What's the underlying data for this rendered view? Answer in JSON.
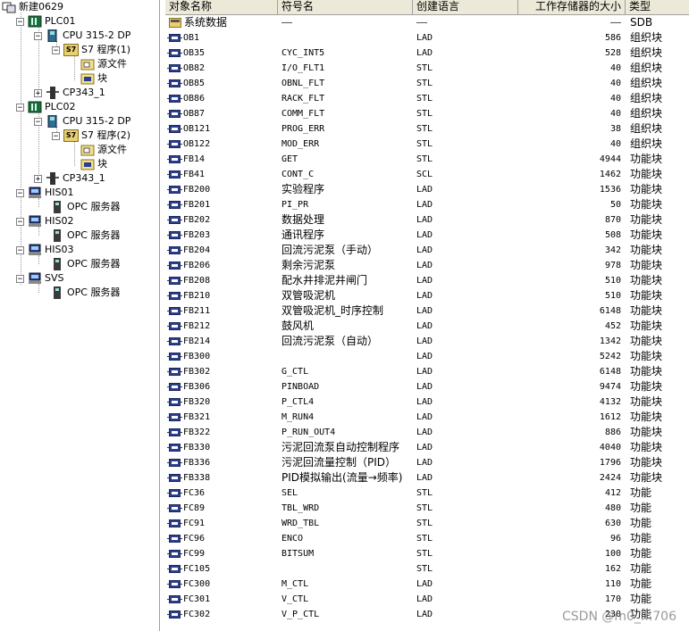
{
  "tree": {
    "project": "新建0629",
    "plc1": "PLC01",
    "cpu1": "CPU 315-2 DP",
    "prog1": "S7 程序(1)",
    "src1": "源文件",
    "blocks1": "块",
    "cp1": "CP343_1",
    "plc2": "PLC02",
    "cpu2": "CPU 315-2 DP",
    "prog2": "S7 程序(2)",
    "src2": "源文件",
    "blocks2": "块",
    "cp2": "CP343_1",
    "his1": "HIS01",
    "opc1": "OPC 服务器",
    "his2": "HIS02",
    "opc2": "OPC 服务器",
    "his3": "HIS03",
    "opc3": "OPC 服务器",
    "svs": "SVS",
    "opc4": "OPC 服务器",
    "s7_badge": "S7"
  },
  "columns": {
    "name": "对象名称",
    "symbol": "符号名",
    "language": "创建语言",
    "size": "工作存储器的大小",
    "type": "类型"
  },
  "rows": [
    {
      "name": "系统数据",
      "symbol": "——",
      "lang": "——",
      "size": "——",
      "type": "SDB"
    },
    {
      "name": "OB1",
      "symbol": "",
      "lang": "LAD",
      "size": "586",
      "type": "组织块"
    },
    {
      "name": "OB35",
      "symbol": "CYC_INT5",
      "lang": "LAD",
      "size": "528",
      "type": "组织块"
    },
    {
      "name": "OB82",
      "symbol": "I/O_FLT1",
      "lang": "STL",
      "size": "40",
      "type": "组织块"
    },
    {
      "name": "OB85",
      "symbol": "OBNL_FLT",
      "lang": "STL",
      "size": "40",
      "type": "组织块"
    },
    {
      "name": "OB86",
      "symbol": "RACK_FLT",
      "lang": "STL",
      "size": "40",
      "type": "组织块"
    },
    {
      "name": "OB87",
      "symbol": "COMM_FLT",
      "lang": "STL",
      "size": "40",
      "type": "组织块"
    },
    {
      "name": "OB121",
      "symbol": "PROG_ERR",
      "lang": "STL",
      "size": "38",
      "type": "组织块"
    },
    {
      "name": "OB122",
      "symbol": "MOD_ERR",
      "lang": "STL",
      "size": "40",
      "type": "组织块"
    },
    {
      "name": "FB14",
      "symbol": "GET",
      "lang": "STL",
      "size": "4944",
      "type": "功能块"
    },
    {
      "name": "FB41",
      "symbol": "CONT_C",
      "lang": "SCL",
      "size": "1462",
      "type": "功能块"
    },
    {
      "name": "FB200",
      "symbol": "实验程序",
      "lang": "LAD",
      "size": "1536",
      "type": "功能块"
    },
    {
      "name": "FB201",
      "symbol": "PI_PR",
      "lang": "LAD",
      "size": "50",
      "type": "功能块"
    },
    {
      "name": "FB202",
      "symbol": "数据处理",
      "lang": "LAD",
      "size": "870",
      "type": "功能块"
    },
    {
      "name": "FB203",
      "symbol": "通讯程序",
      "lang": "LAD",
      "size": "508",
      "type": "功能块"
    },
    {
      "name": "FB204",
      "symbol": "回流污泥泵（手动）",
      "lang": "LAD",
      "size": "342",
      "type": "功能块"
    },
    {
      "name": "FB206",
      "symbol": "剩余污泥泵",
      "lang": "LAD",
      "size": "978",
      "type": "功能块"
    },
    {
      "name": "FB208",
      "symbol": "配水井排泥井闸门",
      "lang": "LAD",
      "size": "510",
      "type": "功能块"
    },
    {
      "name": "FB210",
      "symbol": "双管吸泥机",
      "lang": "LAD",
      "size": "510",
      "type": "功能块"
    },
    {
      "name": "FB211",
      "symbol": "双管吸泥机_时序控制",
      "lang": "LAD",
      "size": "6148",
      "type": "功能块"
    },
    {
      "name": "FB212",
      "symbol": "鼓风机",
      "lang": "LAD",
      "size": "452",
      "type": "功能块"
    },
    {
      "name": "FB214",
      "symbol": "回流污泥泵（自动）",
      "lang": "LAD",
      "size": "1342",
      "type": "功能块"
    },
    {
      "name": "FB300",
      "symbol": "",
      "lang": "LAD",
      "size": "5242",
      "type": "功能块"
    },
    {
      "name": "FB302",
      "symbol": "G_CTL",
      "lang": "LAD",
      "size": "6148",
      "type": "功能块"
    },
    {
      "name": "FB306",
      "symbol": "PINBOAD",
      "lang": "LAD",
      "size": "9474",
      "type": "功能块"
    },
    {
      "name": "FB320",
      "symbol": "P_CTL4",
      "lang": "LAD",
      "size": "4132",
      "type": "功能块"
    },
    {
      "name": "FB321",
      "symbol": "M_RUN4",
      "lang": "LAD",
      "size": "1612",
      "type": "功能块"
    },
    {
      "name": "FB322",
      "symbol": "P_RUN_OUT4",
      "lang": "LAD",
      "size": "886",
      "type": "功能块"
    },
    {
      "name": "FB330",
      "symbol": "污泥回流泵自动控制程序",
      "lang": "LAD",
      "size": "4040",
      "type": "功能块"
    },
    {
      "name": "FB336",
      "symbol": "污泥回流量控制（PID）",
      "lang": "LAD",
      "size": "1796",
      "type": "功能块"
    },
    {
      "name": "FB338",
      "symbol": "PID模拟输出(流量→频率)",
      "lang": "LAD",
      "size": "2424",
      "type": "功能块"
    },
    {
      "name": "FC36",
      "symbol": "SEL",
      "lang": "STL",
      "size": "412",
      "type": "功能"
    },
    {
      "name": "FC89",
      "symbol": "TBL_WRD",
      "lang": "STL",
      "size": "480",
      "type": "功能"
    },
    {
      "name": "FC91",
      "symbol": "WRD_TBL",
      "lang": "STL",
      "size": "630",
      "type": "功能"
    },
    {
      "name": "FC96",
      "symbol": "ENCO",
      "lang": "STL",
      "size": "96",
      "type": "功能"
    },
    {
      "name": "FC99",
      "symbol": "BITSUM",
      "lang": "STL",
      "size": "100",
      "type": "功能"
    },
    {
      "name": "FC105",
      "symbol": "",
      "lang": "STL",
      "size": "162",
      "type": "功能"
    },
    {
      "name": "FC300",
      "symbol": "M_CTL",
      "lang": "LAD",
      "size": "110",
      "type": "功能"
    },
    {
      "name": "FC301",
      "symbol": "V_CTL",
      "lang": "LAD",
      "size": "170",
      "type": "功能"
    },
    {
      "name": "FC302",
      "symbol": "V_P_CTL",
      "lang": "LAD",
      "size": "230",
      "type": "功能"
    }
  ],
  "watermark": "CSDN @m0_...706",
  "colors": {
    "header_bg": "#ece9d8",
    "block_icon": "#2b3f8f",
    "folder": "#e8d070"
  }
}
